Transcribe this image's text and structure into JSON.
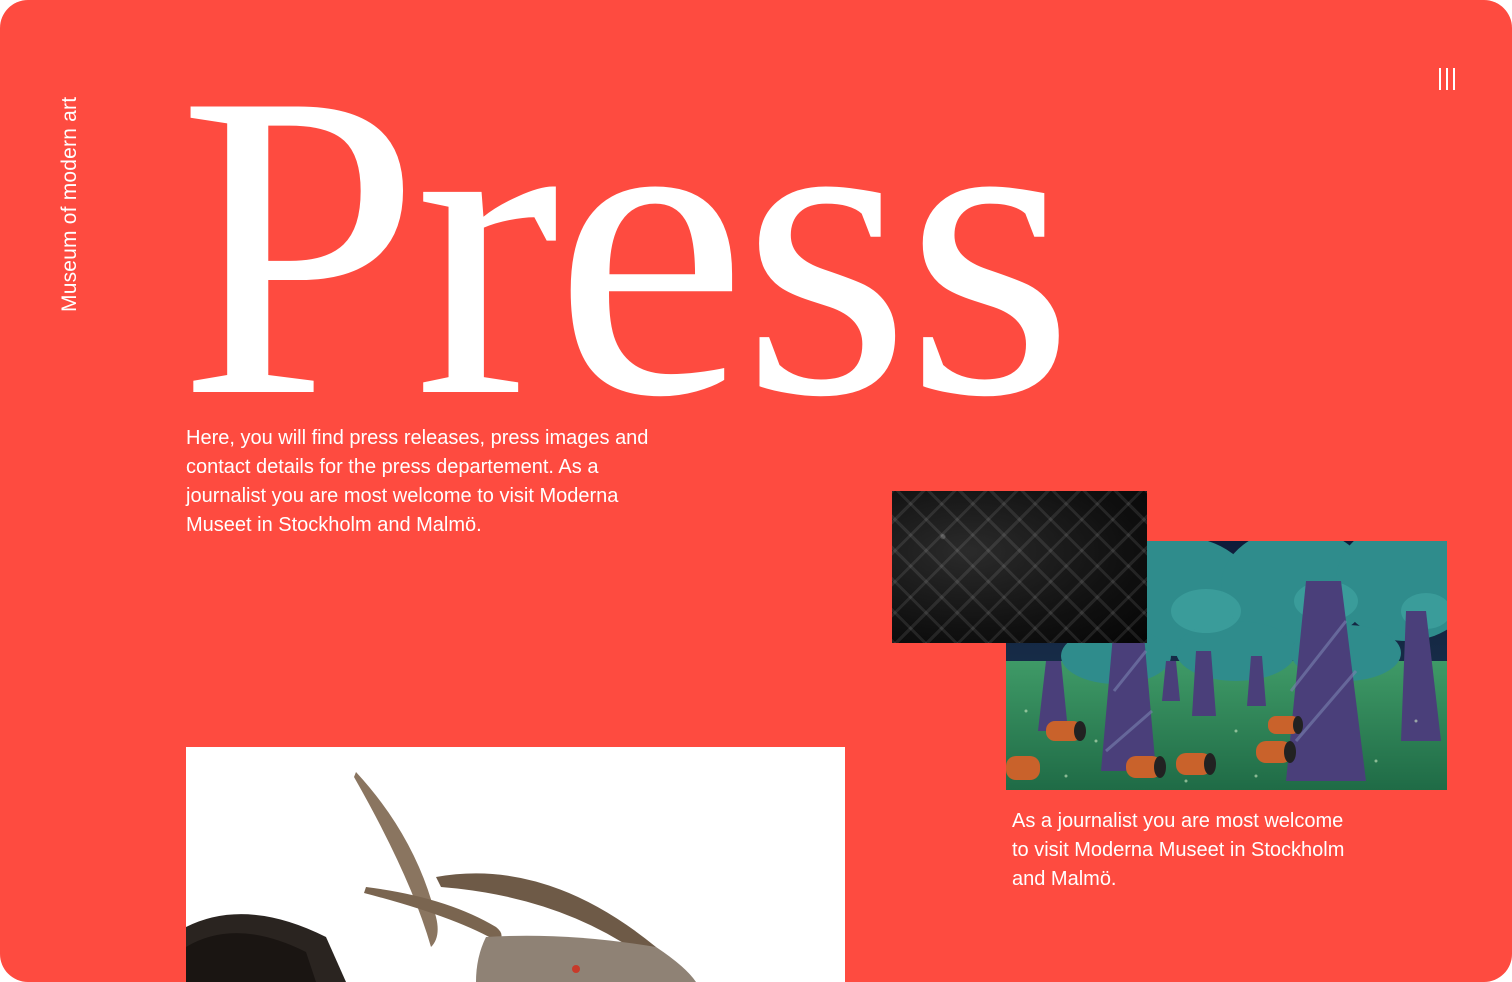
{
  "brand": {
    "name": "Museum of modern art"
  },
  "header": {
    "menu_icon": "menu-bars-icon"
  },
  "main": {
    "title": "Press",
    "intro": "Here, you will find press releases, press images and contact details for the press departement. As a journalist you are most welcome to visit Moderna Museet in Stockholm and Malmö.",
    "caption": "As a journalist you are most welcome to visit Moderna Museet in Stockholm and Malmö."
  },
  "colors": {
    "background": "#fe4b40",
    "text": "#ffffff"
  }
}
